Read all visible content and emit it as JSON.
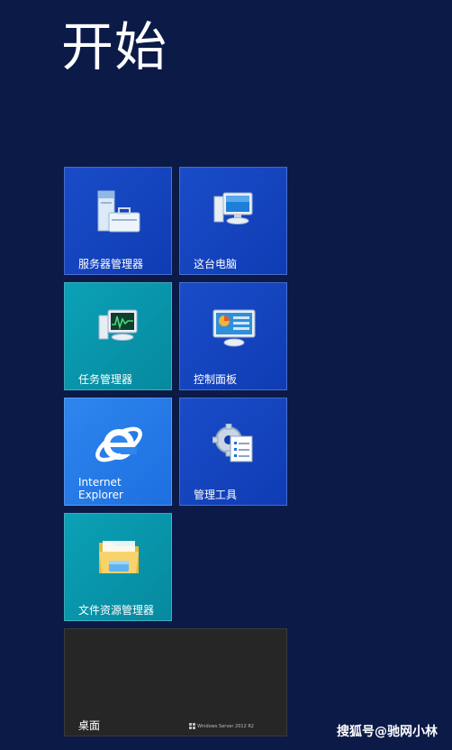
{
  "start": {
    "title": "开始"
  },
  "tiles": [
    {
      "label": "服务器管理器",
      "icon": "server-manager-icon",
      "color": "#1a4cc8"
    },
    {
      "label": "这台电脑",
      "icon": "this-pc-icon",
      "color": "#1a4cc8"
    },
    {
      "label": "任务管理器",
      "icon": "task-manager-icon",
      "color": "#0aa1b6"
    },
    {
      "label": "控制面板",
      "icon": "control-panel-icon",
      "color": "#1a4cc8"
    },
    {
      "label": "Internet Explorer",
      "icon": "internet-explorer-icon",
      "color": "#2e86ee"
    },
    {
      "label": "管理工具",
      "icon": "admin-tools-icon",
      "color": "#1a4cc8"
    },
    {
      "label": "文件资源管理器",
      "icon": "file-explorer-icon",
      "color": "#0aa1b6"
    },
    {
      "label": "桌面",
      "color": "#262626",
      "brand": "Windows Server 2012 R2"
    }
  ],
  "watermark": "搜狐号@驰网小林",
  "colors": {
    "background": "#0b1a47"
  }
}
